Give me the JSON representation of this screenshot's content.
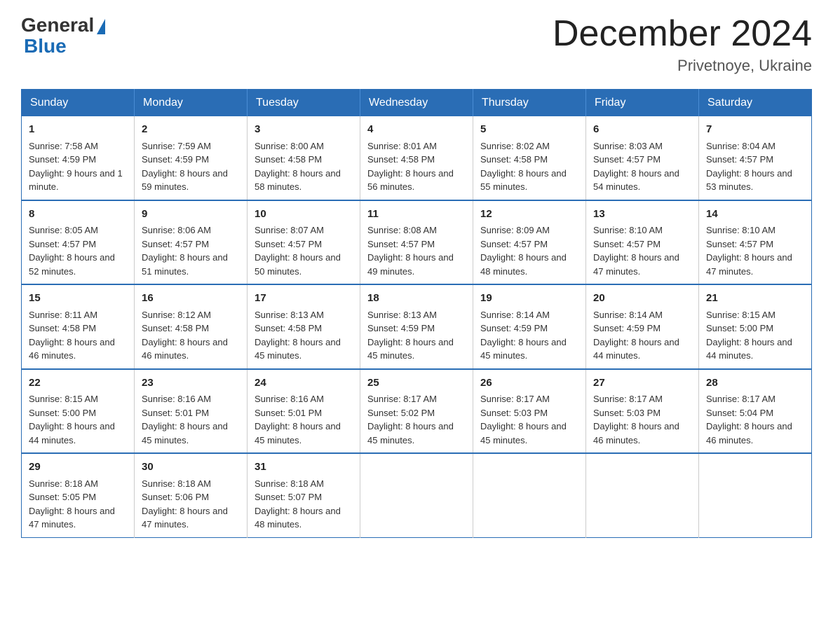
{
  "header": {
    "logo_general": "General",
    "logo_blue": "Blue",
    "month_title": "December 2024",
    "location": "Privetnoye, Ukraine"
  },
  "days_of_week": [
    "Sunday",
    "Monday",
    "Tuesday",
    "Wednesday",
    "Thursday",
    "Friday",
    "Saturday"
  ],
  "weeks": [
    [
      {
        "day": "1",
        "sunrise": "7:58 AM",
        "sunset": "4:59 PM",
        "daylight": "9 hours and 1 minute."
      },
      {
        "day": "2",
        "sunrise": "7:59 AM",
        "sunset": "4:59 PM",
        "daylight": "8 hours and 59 minutes."
      },
      {
        "day": "3",
        "sunrise": "8:00 AM",
        "sunset": "4:58 PM",
        "daylight": "8 hours and 58 minutes."
      },
      {
        "day": "4",
        "sunrise": "8:01 AM",
        "sunset": "4:58 PM",
        "daylight": "8 hours and 56 minutes."
      },
      {
        "day": "5",
        "sunrise": "8:02 AM",
        "sunset": "4:58 PM",
        "daylight": "8 hours and 55 minutes."
      },
      {
        "day": "6",
        "sunrise": "8:03 AM",
        "sunset": "4:57 PM",
        "daylight": "8 hours and 54 minutes."
      },
      {
        "day": "7",
        "sunrise": "8:04 AM",
        "sunset": "4:57 PM",
        "daylight": "8 hours and 53 minutes."
      }
    ],
    [
      {
        "day": "8",
        "sunrise": "8:05 AM",
        "sunset": "4:57 PM",
        "daylight": "8 hours and 52 minutes."
      },
      {
        "day": "9",
        "sunrise": "8:06 AM",
        "sunset": "4:57 PM",
        "daylight": "8 hours and 51 minutes."
      },
      {
        "day": "10",
        "sunrise": "8:07 AM",
        "sunset": "4:57 PM",
        "daylight": "8 hours and 50 minutes."
      },
      {
        "day": "11",
        "sunrise": "8:08 AM",
        "sunset": "4:57 PM",
        "daylight": "8 hours and 49 minutes."
      },
      {
        "day": "12",
        "sunrise": "8:09 AM",
        "sunset": "4:57 PM",
        "daylight": "8 hours and 48 minutes."
      },
      {
        "day": "13",
        "sunrise": "8:10 AM",
        "sunset": "4:57 PM",
        "daylight": "8 hours and 47 minutes."
      },
      {
        "day": "14",
        "sunrise": "8:10 AM",
        "sunset": "4:57 PM",
        "daylight": "8 hours and 47 minutes."
      }
    ],
    [
      {
        "day": "15",
        "sunrise": "8:11 AM",
        "sunset": "4:58 PM",
        "daylight": "8 hours and 46 minutes."
      },
      {
        "day": "16",
        "sunrise": "8:12 AM",
        "sunset": "4:58 PM",
        "daylight": "8 hours and 46 minutes."
      },
      {
        "day": "17",
        "sunrise": "8:13 AM",
        "sunset": "4:58 PM",
        "daylight": "8 hours and 45 minutes."
      },
      {
        "day": "18",
        "sunrise": "8:13 AM",
        "sunset": "4:59 PM",
        "daylight": "8 hours and 45 minutes."
      },
      {
        "day": "19",
        "sunrise": "8:14 AM",
        "sunset": "4:59 PM",
        "daylight": "8 hours and 45 minutes."
      },
      {
        "day": "20",
        "sunrise": "8:14 AM",
        "sunset": "4:59 PM",
        "daylight": "8 hours and 44 minutes."
      },
      {
        "day": "21",
        "sunrise": "8:15 AM",
        "sunset": "5:00 PM",
        "daylight": "8 hours and 44 minutes."
      }
    ],
    [
      {
        "day": "22",
        "sunrise": "8:15 AM",
        "sunset": "5:00 PM",
        "daylight": "8 hours and 44 minutes."
      },
      {
        "day": "23",
        "sunrise": "8:16 AM",
        "sunset": "5:01 PM",
        "daylight": "8 hours and 45 minutes."
      },
      {
        "day": "24",
        "sunrise": "8:16 AM",
        "sunset": "5:01 PM",
        "daylight": "8 hours and 45 minutes."
      },
      {
        "day": "25",
        "sunrise": "8:17 AM",
        "sunset": "5:02 PM",
        "daylight": "8 hours and 45 minutes."
      },
      {
        "day": "26",
        "sunrise": "8:17 AM",
        "sunset": "5:03 PM",
        "daylight": "8 hours and 45 minutes."
      },
      {
        "day": "27",
        "sunrise": "8:17 AM",
        "sunset": "5:03 PM",
        "daylight": "8 hours and 46 minutes."
      },
      {
        "day": "28",
        "sunrise": "8:17 AM",
        "sunset": "5:04 PM",
        "daylight": "8 hours and 46 minutes."
      }
    ],
    [
      {
        "day": "29",
        "sunrise": "8:18 AM",
        "sunset": "5:05 PM",
        "daylight": "8 hours and 47 minutes."
      },
      {
        "day": "30",
        "sunrise": "8:18 AM",
        "sunset": "5:06 PM",
        "daylight": "8 hours and 47 minutes."
      },
      {
        "day": "31",
        "sunrise": "8:18 AM",
        "sunset": "5:07 PM",
        "daylight": "8 hours and 48 minutes."
      },
      null,
      null,
      null,
      null
    ]
  ]
}
